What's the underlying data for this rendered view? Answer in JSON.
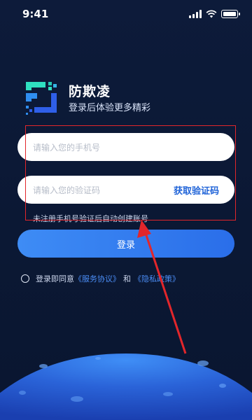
{
  "status_bar": {
    "time": "9:41",
    "icons": [
      "signal-icon",
      "wifi-icon",
      "battery-icon"
    ]
  },
  "header": {
    "app_name": "防欺凌",
    "slogan": "登录后体验更多精彩",
    "logo_icon": "app-logo-icon"
  },
  "form": {
    "phone_placeholder": "请输入您的手机号",
    "code_placeholder": "请输入您的验证码",
    "get_code_label": "获取验证码",
    "hint": "未注册手机号验证后自动创建账号",
    "login_label": "登录"
  },
  "agreement": {
    "prefix": "登录即同意",
    "terms": "《服务协议》",
    "and": "和",
    "privacy": "《隐私政策》"
  },
  "colors": {
    "background": "#0b1834",
    "accent": "#2a6ee9",
    "link": "#4b8df5",
    "annotation": "#e2262b"
  }
}
